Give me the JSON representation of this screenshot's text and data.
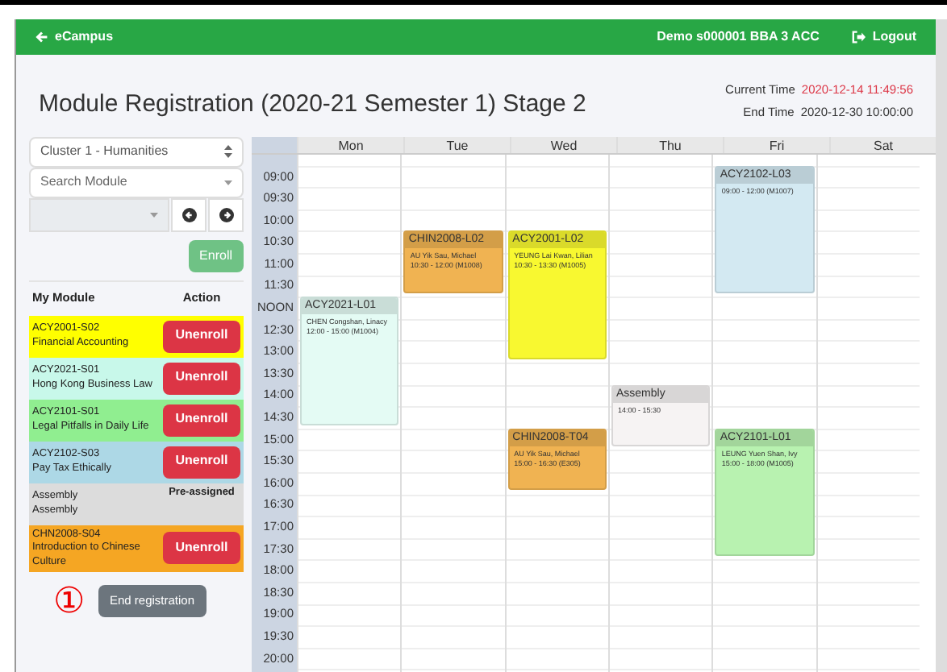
{
  "navbar": {
    "back_label": "eCampus",
    "user": "Demo s000001 BBA 3 ACC",
    "logout": "Logout"
  },
  "title": "Module Registration (2020-21 Semester 1) Stage 2",
  "current_time": {
    "label": "Current Time",
    "value": "2020-12-14 11:49:56"
  },
  "end_time": {
    "label": "End Time",
    "value": "2020-12-30 10:00:00"
  },
  "cluster_select": {
    "value": "Cluster 1 - Humanities"
  },
  "module_search": {
    "placeholder": "Search Module"
  },
  "enroll_button": {
    "label": "Enroll",
    "disabled": true
  },
  "my_modules": {
    "columns": [
      "My Module",
      "Action"
    ],
    "rows": [
      {
        "code": "ACY2001-S02",
        "name": "Financial Accounting",
        "color": "#ffff00",
        "kind": "button",
        "action": "Unenroll"
      },
      {
        "code": "ACY2021-S01",
        "name": "Hong Kong Business Law",
        "color": "#c8f8ea",
        "kind": "button",
        "action": "Unenroll"
      },
      {
        "code": "ACY2101-S01",
        "name": "Legal Pitfalls in Daily Life",
        "color": "#90ee90",
        "kind": "button",
        "action": "Unenroll"
      },
      {
        "code": "ACY2102-S03",
        "name": "Pay Tax Ethically",
        "color": "#add8e6",
        "kind": "button",
        "action": "Unenroll"
      },
      {
        "code": "Assembly",
        "name": "Assembly",
        "color": "#dcdcdc",
        "kind": "text",
        "action": "Pre-assigned"
      },
      {
        "code": "CHN2008-S04",
        "name": "Introduction to Chinese Culture",
        "color": "#f5a623",
        "kind": "button",
        "action": "Unenroll"
      }
    ]
  },
  "step_marker": "①",
  "end_button": "End registration",
  "calendar": {
    "time_labels": [
      "09:00",
      "09:30",
      "10:00",
      "10:30",
      "11:00",
      "11:30",
      "NOON",
      "12:30",
      "13:00",
      "13:30",
      "14:00",
      "14:30",
      "15:00",
      "15:30",
      "16:00",
      "16:30",
      "17:00",
      "17:30",
      "18:00",
      "18:30",
      "19:00",
      "19:30",
      "20:00"
    ],
    "days": [
      {
        "label": "Mon",
        "events": [
          {
            "title": "ACY2021-L01",
            "teacher": "CHEN Congshan, Linacy",
            "time": "12:00 - 15:00 (M1004)",
            "color": "#e4fbf4"
          }
        ]
      },
      {
        "label": "Tue",
        "events": [
          {
            "title": "CHIN2008-L02",
            "teacher": "AU Yik Sau, Michael",
            "time": "10:30 - 12:00 (M1008)",
            "color": "#f0b352"
          }
        ]
      },
      {
        "label": "Wed",
        "events": [
          {
            "title": "ACY2001-L02",
            "teacher": "YEUNG Lai Kwan, Lilian",
            "time": "10:30 - 13:30 (M1005)",
            "color": "#f8f830"
          },
          {
            "title": "CHIN2008-T04",
            "teacher": "AU Yik Sau, Michael",
            "time": "15:00 - 16:30 (E305)",
            "color": "#f0b352"
          }
        ]
      },
      {
        "label": "Thu",
        "events": [
          {
            "title": "Assembly",
            "time": "14:00 - 15:30",
            "color": "#f6f3f3"
          }
        ]
      },
      {
        "label": "Fri",
        "events": [
          {
            "title": "ACY2102-L03",
            "time": "09:00 - 12:00 (M1007)",
            "color": "#d3e9f2"
          },
          {
            "title": "ACY2101-L01",
            "teacher": "LEUNG Yuen Shan, Ivy",
            "time": "15:00 - 18:00 (M1005)",
            "color": "#b8f2b0"
          }
        ]
      },
      {
        "label": "Sat"
      }
    ]
  }
}
